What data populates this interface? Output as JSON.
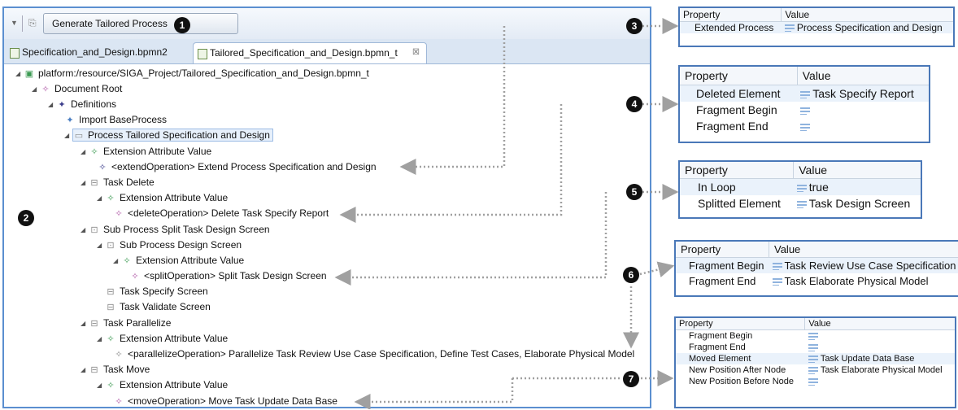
{
  "editor": {
    "generate_label": "Generate Tailored Process",
    "tabs": [
      {
        "label": "Specification_and_Design.bpmn2"
      },
      {
        "label": "Tailored_Specification_and_Design.bpmn_t",
        "close": "☒"
      }
    ],
    "tree": [
      "platform:/resource/SIGA_Project/Tailored_Specification_and_Design.bpmn_t",
      "Document Root",
      "Definitions",
      "Import BaseProcess",
      "Process Tailored Specification and Design",
      "Extension Attribute Value",
      "<extendOperation> Extend Process Specification and Design",
      "Task Delete",
      "Extension Attribute Value",
      "<deleteOperation> Delete Task Specify Report",
      "Sub Process Split Task Design Screen",
      "Sub Process Design Screen",
      "Extension Attribute Value",
      "<splitOperation> Split Task Design Screen",
      "Task Specify Screen",
      "Task Validate Screen",
      "Task Parallelize",
      "Extension Attribute Value",
      "<parallelizeOperation> Parallelize Task Review Use Case Specification, Define Test Cases, Elaborate Physical Model",
      "Task Move",
      "Extension Attribute Value",
      "<moveOperation> Move Task Update Data Base"
    ]
  },
  "badges": [
    "1",
    "2",
    "3",
    "4",
    "5",
    "6",
    "7"
  ],
  "property_tables": [
    {
      "header": [
        "Property",
        "Value"
      ],
      "rows": [
        [
          "Extended Process",
          "Process Specification and Design"
        ]
      ]
    },
    {
      "header": [
        "Property",
        "Value"
      ],
      "rows": [
        [
          "Deleted Element",
          "Task Specify Report"
        ],
        [
          "Fragment Begin",
          ""
        ],
        [
          "Fragment End",
          ""
        ]
      ]
    },
    {
      "header": [
        "Property",
        "Value"
      ],
      "rows": [
        [
          "In Loop",
          "true"
        ],
        [
          "Splitted Element",
          "Task Design Screen"
        ]
      ]
    },
    {
      "header": [
        "Property",
        "Value"
      ],
      "rows": [
        [
          "Fragment Begin",
          "Task Review Use Case Specification"
        ],
        [
          "Fragment End",
          "Task Elaborate Physical Model"
        ]
      ]
    },
    {
      "header": [
        "Property",
        "Value"
      ],
      "rows": [
        [
          "Fragment Begin",
          ""
        ],
        [
          "Fragment End",
          ""
        ],
        [
          "Moved Element",
          "Task Update Data Base"
        ],
        [
          "New Position After Node",
          "Task Elaborate Physical Model"
        ],
        [
          "New Position Before Node",
          ""
        ]
      ]
    }
  ],
  "colors": {
    "frame": "#5b8fd0",
    "table_border": "#4a78b8",
    "arrow": "#a0a0a0"
  }
}
